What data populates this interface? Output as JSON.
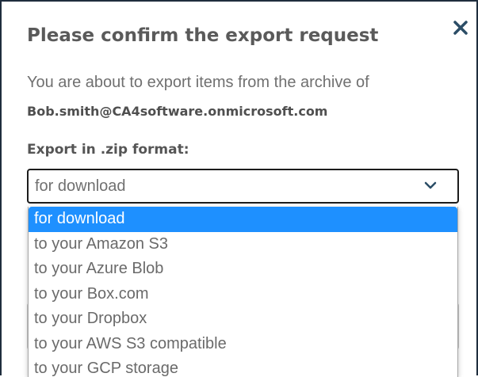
{
  "dialog": {
    "title": "Please confirm the export request",
    "description": "You are about to export items from the archive of",
    "email": "Bob.smith@CA4software.onmicrosoft.com",
    "format_label": "Export in .zip format:",
    "close_icon": "close-icon",
    "accent_color": "#1e90ff",
    "close_color": "#2b4d66"
  },
  "select": {
    "value": "for download",
    "icon": "chevron-down-icon",
    "options": [
      {
        "label": "for download",
        "selected": true
      },
      {
        "label": "to your Amazon S3",
        "selected": false
      },
      {
        "label": "to your Azure Blob",
        "selected": false
      },
      {
        "label": "to your Box.com",
        "selected": false
      },
      {
        "label": "to your Dropbox",
        "selected": false
      },
      {
        "label": "to your AWS S3 compatible",
        "selected": false
      },
      {
        "label": "to your GCP storage",
        "selected": false
      }
    ]
  }
}
